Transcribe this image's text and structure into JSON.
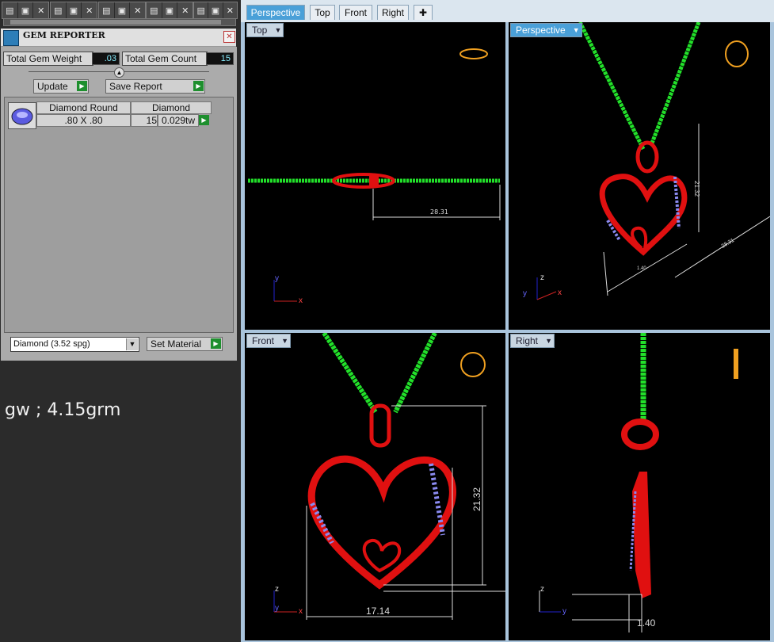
{
  "toolbar": {
    "groups": [
      {
        "buttons": [
          "save-icon",
          "copy-icon",
          "close-icon"
        ]
      },
      {
        "buttons": [
          "save-icon",
          "copy-icon",
          "close-icon"
        ]
      },
      {
        "buttons": [
          "save-icon",
          "copy-icon",
          "close-icon"
        ]
      },
      {
        "buttons": [
          "save-icon",
          "copy-icon",
          "close-icon"
        ]
      },
      {
        "buttons": [
          "save-icon",
          "copy-icon",
          "close-icon"
        ]
      }
    ]
  },
  "panel": {
    "title": "GEM REPORTER",
    "total_weight_label": "Total Gem Weight",
    "total_weight_value": ".03",
    "total_count_label": "Total Gem Count",
    "total_count_value": "15",
    "update_label": "Update",
    "save_report_label": "Save Report",
    "gem_table": {
      "headers": [
        "Diamond Round",
        "Diamond"
      ],
      "row": {
        "size": ".80 X .80",
        "count": "15",
        "weight": "0.029tw"
      }
    },
    "material_select": "Diamond    (3.52 spg)",
    "set_material_label": "Set Material",
    "note": "gw ; 4.15grm"
  },
  "viewports": {
    "tabs": [
      "Perspective",
      "Top",
      "Front",
      "Right"
    ],
    "active_tab": "Perspective",
    "views": {
      "top": {
        "label": "Top",
        "dimension": "28.31"
      },
      "perspective": {
        "label": "Perspective",
        "dim_a": "28.31",
        "dim_b": "21.32",
        "dim_c": "1.40"
      },
      "front": {
        "label": "Front",
        "dim_width": "17.14",
        "dim_height": "21.32"
      },
      "right": {
        "label": "Right",
        "dim_depth": "1.40"
      }
    }
  },
  "colors": {
    "accent": "#4aa0d8",
    "chain": "#22e02a",
    "metal": "#e01010",
    "gem": "#8a8af0"
  }
}
